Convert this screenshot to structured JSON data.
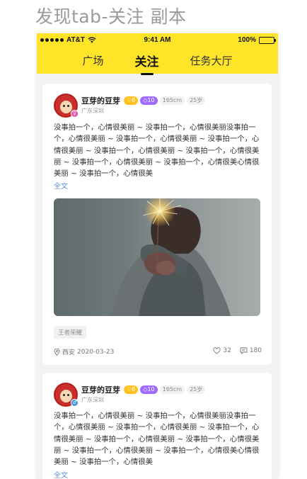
{
  "artboard": {
    "title": "发现tab-关注 副本"
  },
  "status_bar": {
    "carrier": "AT&T",
    "time": "9:41 AM",
    "battery": "100%",
    "battery_level": 1.0
  },
  "tabs": [
    {
      "label": "广场",
      "active": false
    },
    {
      "label": "关注",
      "active": true
    },
    {
      "label": "任务大厅",
      "active": false
    }
  ],
  "colors": {
    "brand_yellow": "#ffe428",
    "link_blue": "#5b8fd9",
    "level_tag": "#ffc21f",
    "vip_tag": "#a16bff"
  },
  "posts": [
    {
      "username": "豆芽的豆芽",
      "level": "6",
      "vip": "10",
      "height": "165cm",
      "age": "25岁",
      "location": "广东深圳",
      "avatar_badge_icon": "female-icon",
      "avatar_badge_color": "#e84fa8",
      "text": "没事拍一个，心情很美丽 ~ 没事拍一个，心情很美丽没事拍一个，心情很美丽 ~ 没事拍一个，心情很美丽 ~ 没事拍一个，心情很美丽 ~ 没事拍一个，心情很美丽 ~ 没事拍一个，心情很美丽 ~ 没事拍一个，心情很美丽 ~ 没事拍一个，心情很美心情很美丽 ~ 没事拍一个，心情很美",
      "full_text_link": "全文",
      "image_icon": "sparkler-photo",
      "topic_chip": "王者荣耀",
      "place": "西安",
      "date": "2020-03-23",
      "likes": "32",
      "comments": "180"
    },
    {
      "username": "豆芽的豆芽",
      "level": "6",
      "vip": "10",
      "height": "165cm",
      "age": "25岁",
      "location": "广东深圳",
      "avatar_badge_icon": "male-icon",
      "avatar_badge_color": "#4a90e2",
      "text": "没事拍一个，心情很美丽 ~ 没事拍一个，心情很美丽没事拍一个，心情很美丽 ~ 没事拍一个，心情很美丽 ~ 没事拍一个，心情很美丽 ~ 没事拍一个，心情很美丽 ~ 没事拍一个，心情很美丽 ~ 没事拍一个，心情很美丽 ~ 没事拍一个，心情很美心情很美丽 ~ 没事拍一个，心情很美",
      "full_text_link": "全文"
    }
  ]
}
